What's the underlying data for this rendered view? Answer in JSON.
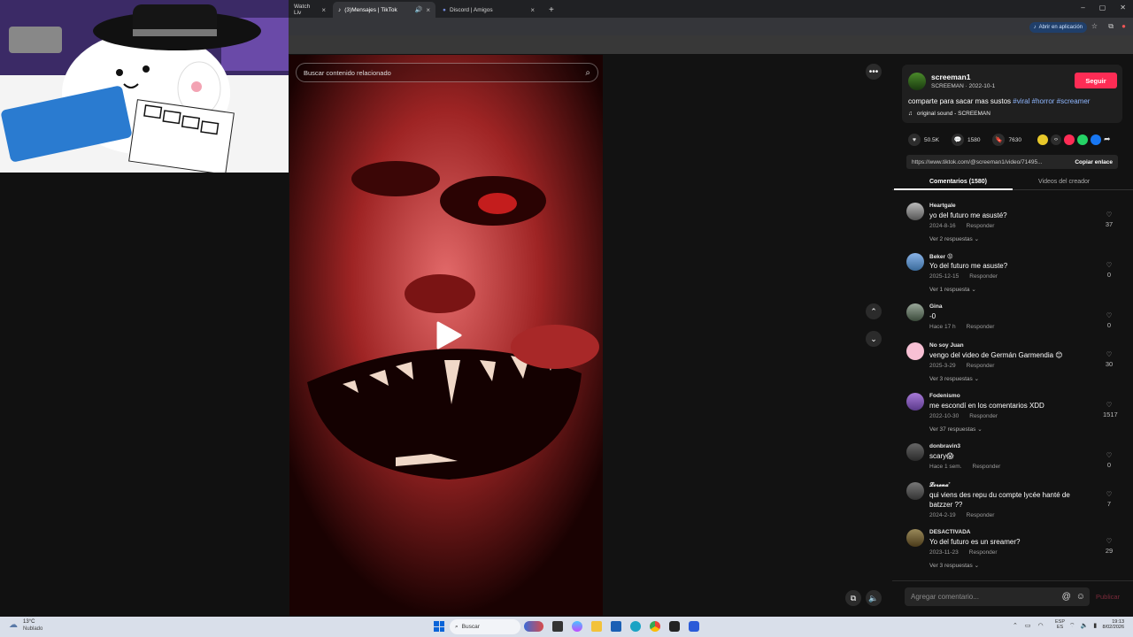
{
  "browser": {
    "tabs": [
      {
        "label": "Watch Liv",
        "active": false
      },
      {
        "label": "(3)Mensajes | TikTok",
        "active": true
      },
      {
        "label": "Discord | Amigos",
        "active": false
      }
    ],
    "open_app_label": "Abrir en aplicación"
  },
  "video": {
    "search_placeholder": "Buscar contenido relacionado"
  },
  "creator": {
    "username": "screeman1",
    "subtitle": "SCREEMAN · 2022-10-1",
    "follow_label": "Seguir",
    "caption": "comparte para sacar mas sustos",
    "hashtags": [
      "#viral",
      "#horror",
      "#screamer"
    ],
    "sound": "original sound - SCREEMAN"
  },
  "stats": {
    "likes": "50.5K",
    "comments": "1580",
    "saves": "7630"
  },
  "link": {
    "url": "https://www.tiktok.com/@screeman1/video/71495...",
    "copy_label": "Copiar enlace"
  },
  "panel_tabs": {
    "comments": "Comentarios (1580)",
    "creator_videos": "Videos del creador"
  },
  "comments": [
    {
      "user": "Heartgale",
      "text": "yo del futuro me asusté?",
      "date": "2024-8-16",
      "reply": "Responder",
      "likes": "37",
      "replies": "Ver 2 respuestas ⌄"
    },
    {
      "user": "Beker 😡",
      "text": "Yo del futuro me asuste?",
      "date": "2025-12-15",
      "reply": "Responder",
      "likes": "0",
      "replies": "Ver 1 respuesta ⌄"
    },
    {
      "user": "Gina",
      "text": "-0",
      "date": "Hace 17 h",
      "reply": "Responder",
      "likes": "0",
      "replies": ""
    },
    {
      "user": "No soy Juan",
      "text": "vengo del video de Germán Garmendia 😊",
      "date": "2025-3-29",
      "reply": "Responder",
      "likes": "30",
      "replies": "Ver 3 respuestas ⌄"
    },
    {
      "user": "Fodenismo",
      "text": "me escondí en los comentarios XDD",
      "date": "2022-10-30",
      "reply": "Responder",
      "likes": "1517",
      "replies": "Ver 37 respuestas ⌄"
    },
    {
      "user": "donbravin3",
      "text": "scary😱",
      "date": "Hace 1 sem.",
      "reply": "Responder",
      "likes": "0",
      "replies": ""
    },
    {
      "user": "𝓛𝓸𝓻𝓮𝓷𝓪˚",
      "text": "qui viens des repu du compte lycée hanté de batzzer ??",
      "date": "2024-2-19",
      "reply": "Responder",
      "likes": "7",
      "replies": ""
    },
    {
      "user": "DESACTIVADA",
      "text": "Yo del futuro es un sreamer?",
      "date": "2023-11-23",
      "reply": "Responder",
      "likes": "29",
      "replies": "Ver 3 respuestas ⌄"
    }
  ],
  "comment_input": {
    "placeholder": "Agregar comentario...",
    "publish_label": "Publicar"
  },
  "taskbar": {
    "weather_temp": "13°C",
    "weather_desc": "Nublado",
    "search_label": "Buscar",
    "lang": "ESP",
    "lang2": "ES",
    "time": "19:13",
    "date": "8/02/2026"
  }
}
